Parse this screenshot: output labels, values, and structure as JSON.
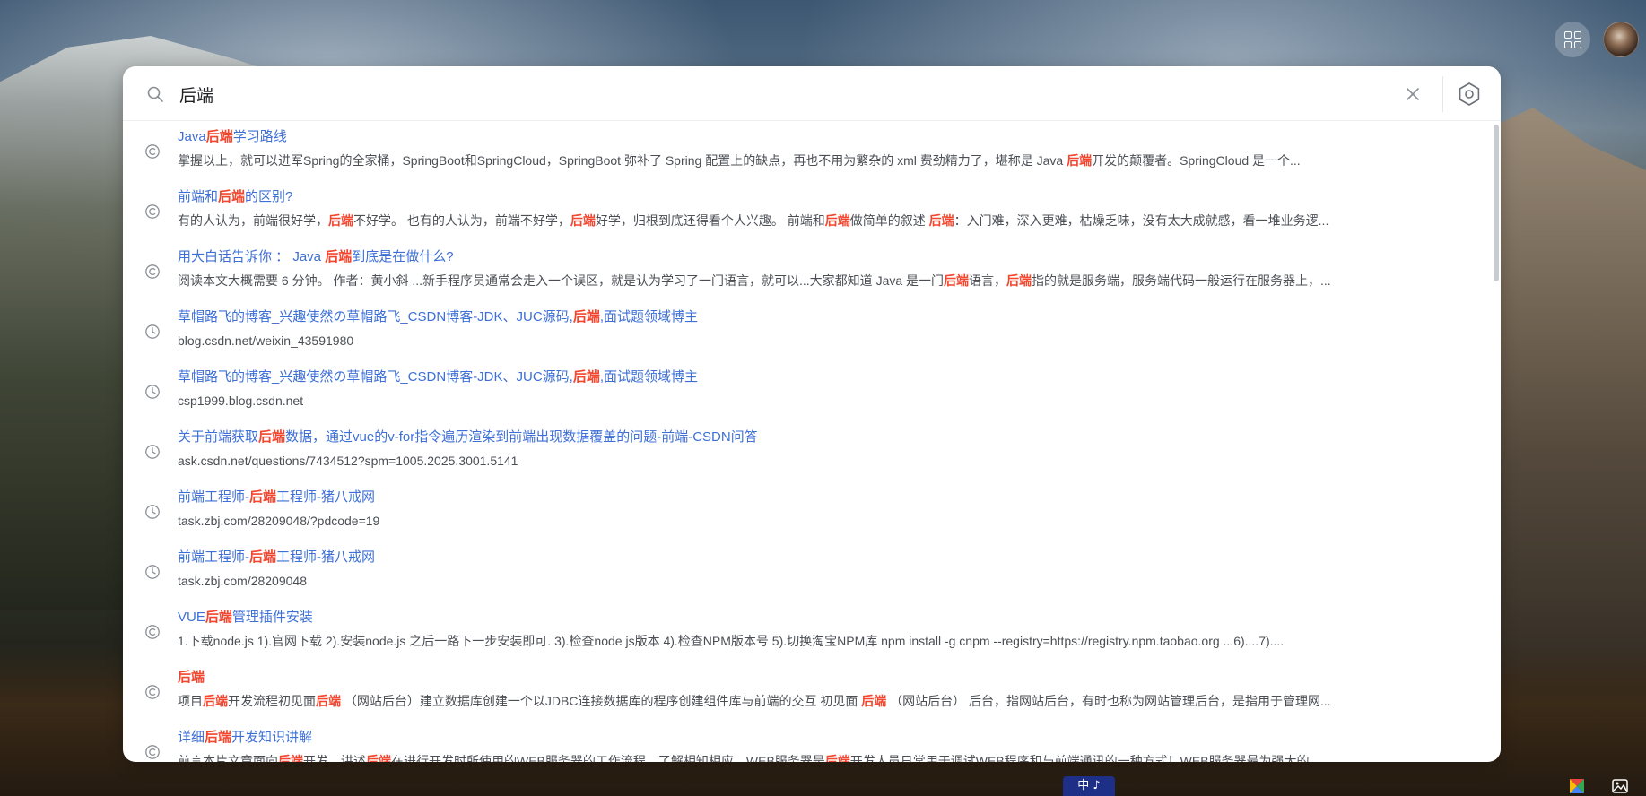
{
  "search": {
    "query": "后端",
    "highlight": "后端"
  },
  "header_buttons": {
    "apps_icon": "apps-grid-icon",
    "avatar": "user-avatar"
  },
  "colors": {
    "title_link": "#3d6fd6",
    "highlight": "#f2462f",
    "description": "#4b4f55"
  },
  "results": [
    {
      "type": "suggestion",
      "icon": "copyright-circle-icon",
      "title": "Java后端学习路线",
      "desc": "掌握以上，就可以进军Spring的全家桶，SpringBoot和SpringCloud，SpringBoot 弥补了 Spring 配置上的缺点，再也不用为繁杂的 xml 费劲精力了，堪称是 Java 后端开发的颠覆者。SpringCloud 是一个..."
    },
    {
      "type": "suggestion",
      "icon": "copyright-circle-icon",
      "title": "前端和后端的区别?",
      "desc": "有的人认为，前端很好学，后端不好学。 也有的人认为，前端不好学，后端好学，归根到底还得看个人兴趣。 前端和后端做简单的叙述 后端：入门难，深入更难，枯燥乏味，没有太大成就感，看一堆业务逻..."
    },
    {
      "type": "suggestion",
      "icon": "copyright-circle-icon",
      "title": "用大白话告诉你 ： Java 后端到底是在做什么?",
      "desc": "阅读本文大概需要 6 分钟。 作者：黄小斜 ...新手程序员通常会走入一个误区，就是认为学习了一门语言，就可以...大家都知道 Java 是一门后端语言，后端指的就是服务端，服务端代码一般运行在服务器上，..."
    },
    {
      "type": "history",
      "icon": "clock-icon",
      "title": "草帽路飞的博客_兴趣使然の草帽路飞_CSDN博客-JDK、JUC源码,后端,面试题领域博主",
      "desc": "blog.csdn.net/weixin_43591980"
    },
    {
      "type": "history",
      "icon": "clock-icon",
      "title": "草帽路飞的博客_兴趣使然の草帽路飞_CSDN博客-JDK、JUC源码,后端,面试题领域博主",
      "desc": "csp1999.blog.csdn.net"
    },
    {
      "type": "history",
      "icon": "clock-icon",
      "title": "关于前端获取后端数据，通过vue的v-for指令遍历渲染到前端出现数据覆盖的问题-前端-CSDN问答",
      "desc": "ask.csdn.net/questions/7434512?spm=1005.2025.3001.5141"
    },
    {
      "type": "history",
      "icon": "clock-icon",
      "title": "前端工程师-后端工程师-猪八戒网",
      "desc": "task.zbj.com/28209048/?pdcode=19"
    },
    {
      "type": "history",
      "icon": "clock-icon",
      "title": "前端工程师-后端工程师-猪八戒网",
      "desc": "task.zbj.com/28209048"
    },
    {
      "type": "suggestion",
      "icon": "copyright-circle-icon",
      "title": "VUE后端管理插件安装",
      "desc": "1.下载node.js 1).官网下载 2).安装node.js 之后一路下一步安装即可. 3).检查node js版本 4).检查NPM版本号 5).切换淘宝NPM库 npm install -g cnpm --registry=https://registry.npm.taobao.org ...6)....7)...."
    },
    {
      "type": "suggestion",
      "icon": "copyright-circle-icon",
      "title": "后端",
      "desc": "项目后端开发流程初见面后端 （网站后台）建立数据库创建一个以JDBC连接数据库的程序创建组件库与前端的交互 初见面 后端 （网站后台） 后台，指网站后台，有时也称为网站管理后台，是指用于管理网..."
    },
    {
      "type": "suggestion",
      "icon": "copyright-circle-icon",
      "title": "详细后端开发知识讲解",
      "desc": "前言本片文章面向后端开发，讲述后端在进行开发时所使用的WEB服务器的工作流程，了解相知相应，WEB服务器是后端开发人员日常用于调试WEB程序和与前端通讯的一种方式！WEB服务器最为强大的..."
    }
  ],
  "taskbar": {
    "widget_label": "中 ♪",
    "tray_icons": [
      "color-picker-icon",
      "image-icon"
    ]
  }
}
